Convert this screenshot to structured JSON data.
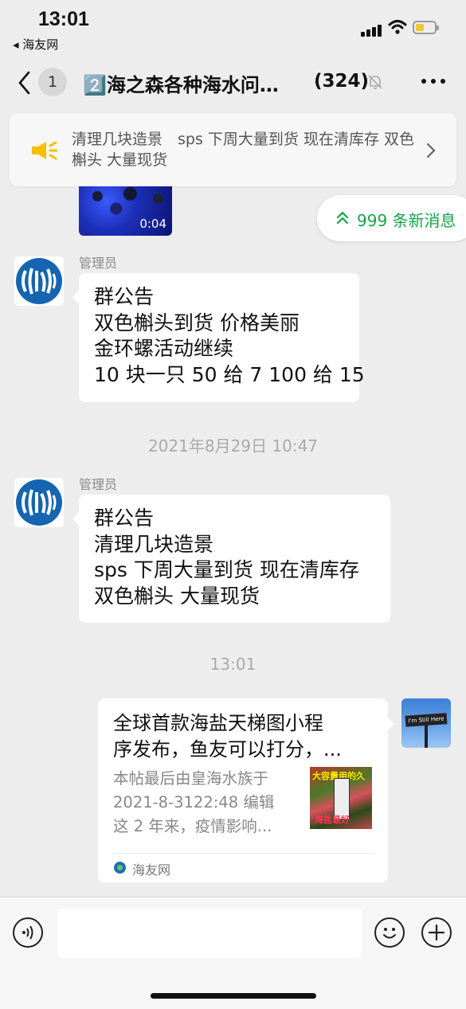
{
  "status_bar": {
    "time": "13:01",
    "back_app": "◂ 海友网"
  },
  "nav": {
    "badge": "1",
    "title": "2️⃣海之森各种海水问…",
    "member_count": "(324)"
  },
  "announcement_banner": {
    "text": "清理几块造景　sps 下周大量到货 现在清库存 双色槲头 大量现货"
  },
  "video": {
    "duration": "0:04"
  },
  "new_messages_pill": {
    "label": "999 条新消息"
  },
  "messages": [
    {
      "sender": "管理员",
      "lines": [
        "群公告",
        "双色槲头到货 价格美丽",
        "金环螺活动继续",
        "10 块一只 50 给 7 100 给 15"
      ]
    },
    {
      "timestamp": "2021年8月29日 10:47",
      "sender": "管理员",
      "lines": [
        "群公告",
        "清理几块造景",
        "sps 下周大量到货 现在清库存",
        "双色槲头 大量现货"
      ]
    }
  ],
  "time_divider": "13:01",
  "link_card": {
    "title_lines": [
      "全球首款海盐天梯图小程",
      "序发布，鱼友可以打分，..."
    ],
    "desc_lines": [
      "本帖最后由皇海水族于",
      "2021-8-3122:48 编辑",
      "这 2 年来，疫情影响..."
    ],
    "thumb_top": "大容量用的久",
    "thumb_bottom": "海盐最好",
    "source": "海友网"
  },
  "my_avatar_sign": "I'm Still Here",
  "input": {
    "placeholder": ""
  },
  "colors": {
    "accent_green": "#17a34a",
    "chat_bg": "#ededed",
    "battery": "#f4c430"
  }
}
